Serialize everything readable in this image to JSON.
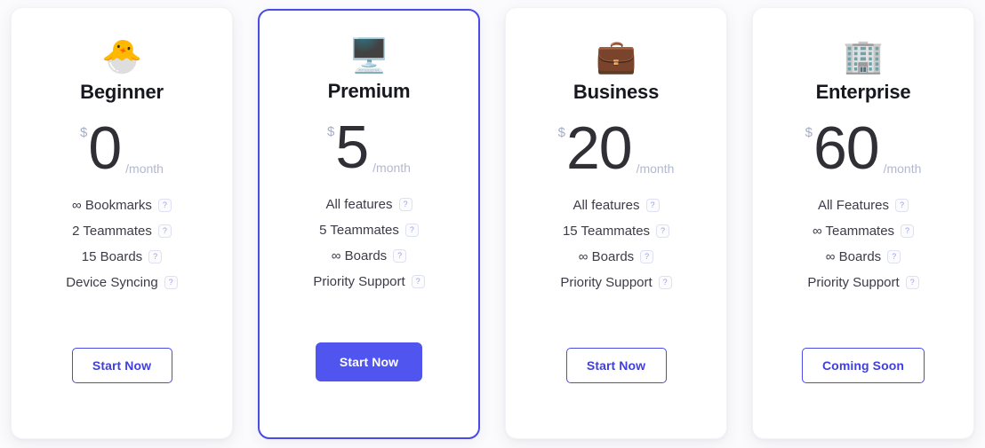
{
  "page": {
    "background_color": "#fbfbfd",
    "accent_color": "#4a4ae8",
    "featured_button_color": "#4f55ee"
  },
  "plans": [
    {
      "id": "beginner",
      "icon": "🐣",
      "icon_name": "hatching-chick-icon",
      "name": "Beginner",
      "currency": "$",
      "amount": "0",
      "period": "/month",
      "featured": false,
      "features": [
        {
          "text": "∞ Bookmarks",
          "help": "?"
        },
        {
          "text": "2 Teammates",
          "help": "?"
        },
        {
          "text": "15 Boards",
          "help": "?"
        },
        {
          "text": "Device Syncing",
          "help": "?"
        }
      ],
      "cta": {
        "label": "Start Now",
        "style": "outline"
      }
    },
    {
      "id": "premium",
      "icon": "🖥️",
      "icon_name": "desktop-computer-icon",
      "name": "Premium",
      "currency": "$",
      "amount": "5",
      "period": "/month",
      "featured": true,
      "features": [
        {
          "text": "All features",
          "help": "?"
        },
        {
          "text": "5 Teammates",
          "help": "?"
        },
        {
          "text": "∞ Boards",
          "help": "?"
        },
        {
          "text": "Priority Support",
          "help": "?"
        }
      ],
      "cta": {
        "label": "Start Now",
        "style": "solid"
      }
    },
    {
      "id": "business",
      "icon": "💼",
      "icon_name": "briefcase-icon",
      "name": "Business",
      "currency": "$",
      "amount": "20",
      "period": "/month",
      "featured": false,
      "features": [
        {
          "text": "All features",
          "help": "?"
        },
        {
          "text": "15 Teammates",
          "help": "?"
        },
        {
          "text": "∞ Boards",
          "help": "?"
        },
        {
          "text": "Priority Support",
          "help": "?"
        }
      ],
      "cta": {
        "label": "Start Now",
        "style": "outline"
      }
    },
    {
      "id": "enterprise",
      "icon": "🏢",
      "icon_name": "office-building-icon",
      "name": "Enterprise",
      "currency": "$",
      "amount": "60",
      "period": "/month",
      "featured": false,
      "features": [
        {
          "text": "All Features",
          "help": "?"
        },
        {
          "text": "∞ Teammates",
          "help": "?"
        },
        {
          "text": "∞ Boards",
          "help": "?"
        },
        {
          "text": "Priority Support",
          "help": "?"
        }
      ],
      "cta": {
        "label": "Coming Soon",
        "style": "outline"
      }
    }
  ]
}
